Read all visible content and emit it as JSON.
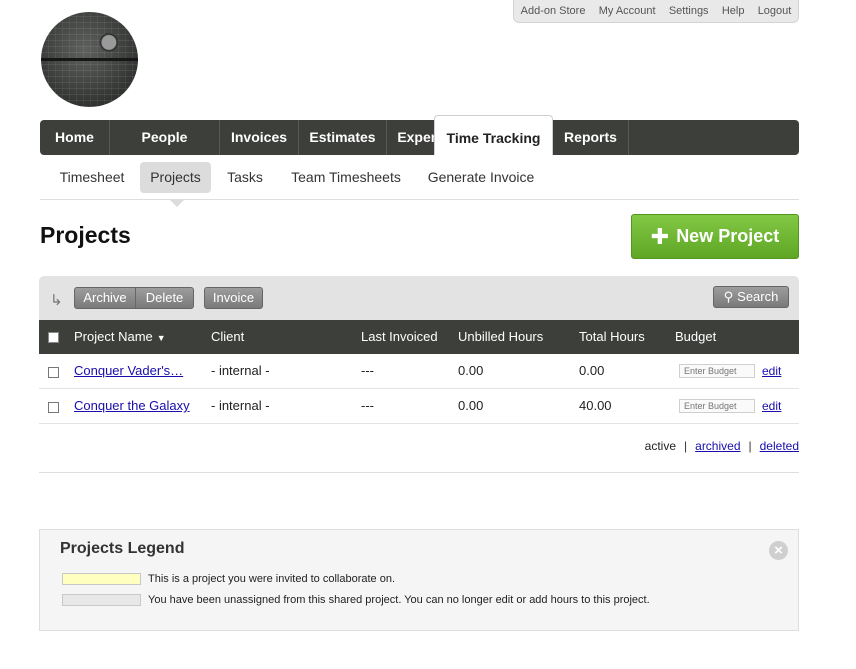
{
  "util_nav": [
    "Add-on Store",
    "My Account",
    "Settings",
    "Help",
    "Logout"
  ],
  "main_nav": {
    "items": [
      "Home",
      "People",
      "Invoices",
      "Estimates",
      "Expenses",
      "Time Tracking",
      "Reports"
    ],
    "active": "Time Tracking"
  },
  "sub_nav": {
    "items": [
      "Timesheet",
      "Projects",
      "Tasks",
      "Team Timesheets",
      "Generate Invoice"
    ],
    "active": "Projects"
  },
  "page": {
    "title": "Projects",
    "new_project_label": "New Project",
    "new_project_icon": "plus-icon"
  },
  "toolbar": {
    "return_icon": "return-arrow-icon",
    "archive_label": "Archive",
    "delete_label": "Delete",
    "invoice_label": "Invoice",
    "search_label": "Search",
    "search_icon": "magnifier-icon"
  },
  "table": {
    "columns": [
      "Project Name",
      "Client",
      "Last Invoiced",
      "Unbilled Hours",
      "Total Hours",
      "Budget"
    ],
    "sort_indicator": "▼",
    "rows": [
      {
        "name": "Conquer Vader's…",
        "client": "- internal -",
        "last_invoiced": "---",
        "unbilled": "0.00",
        "total": "0.00",
        "budget_placeholder": "Enter Budget",
        "edit": "edit"
      },
      {
        "name": "Conquer the Galaxy",
        "client": "- internal -",
        "last_invoiced": "---",
        "unbilled": "0.00",
        "total": "40.00",
        "budget_placeholder": "Enter Budget",
        "edit": "edit"
      }
    ]
  },
  "filter": {
    "active": "active",
    "archived": "archived",
    "deleted": "deleted",
    "separator": "|"
  },
  "legend": {
    "title": "Projects Legend",
    "items": [
      {
        "text": "This is a project you were invited to collaborate on.",
        "color": "#ffffbf"
      },
      {
        "text": "You have been unassigned from this shared project. You can no longer edit or add hours to this project.",
        "color": "#e8e8e8"
      }
    ]
  },
  "colors": {
    "nav_bg": "#3d3f3b",
    "accent_green": "#6db82f",
    "link": "#1a0dab"
  }
}
